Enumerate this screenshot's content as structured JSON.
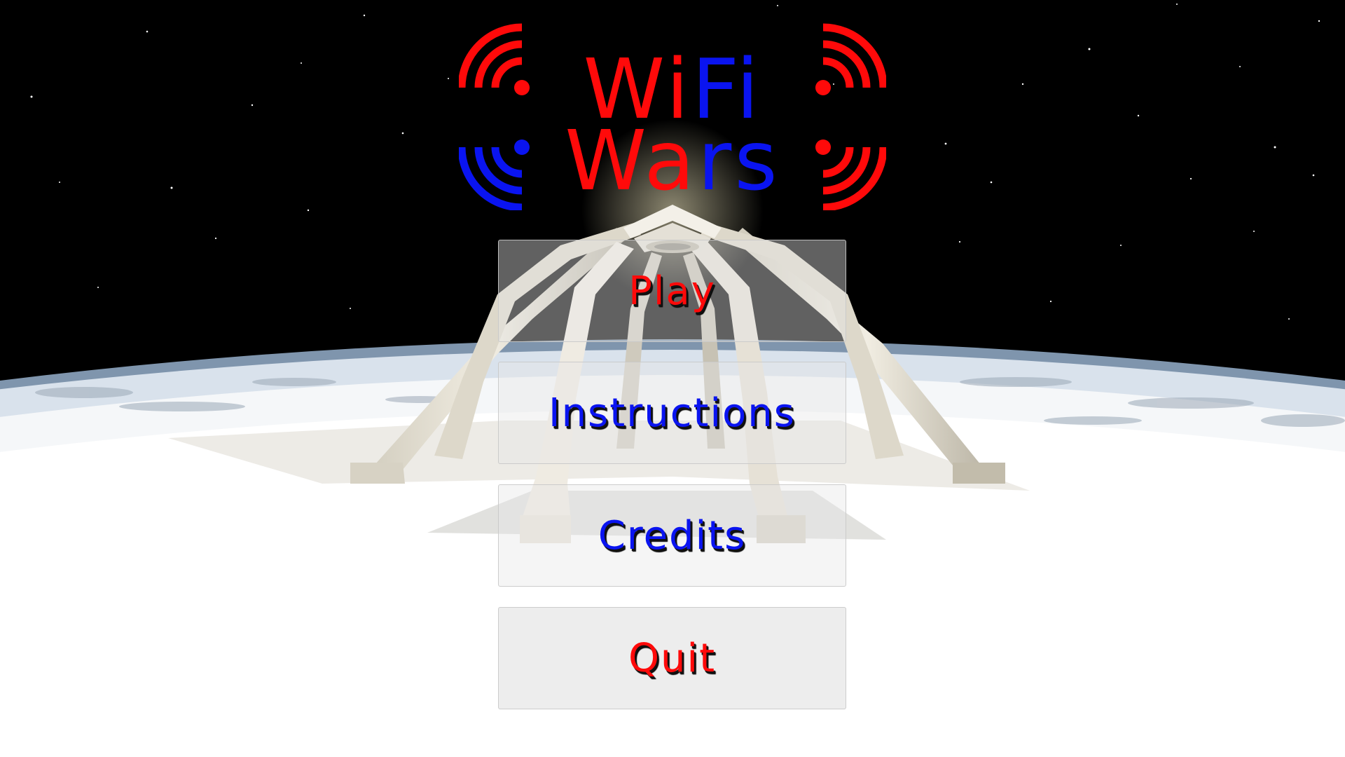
{
  "logo": {
    "line1_red": "Wi",
    "line1_blue": "Fi",
    "line2_red": "Wa",
    "line2_blue": "rs"
  },
  "menu": {
    "play": "Play",
    "instructions": "Instructions",
    "credits": "Credits",
    "quit": "Quit"
  },
  "colors": {
    "red": "#ff0a0a",
    "blue": "#0a14f0",
    "space": "#000000",
    "planet": "#f4f6f8"
  }
}
